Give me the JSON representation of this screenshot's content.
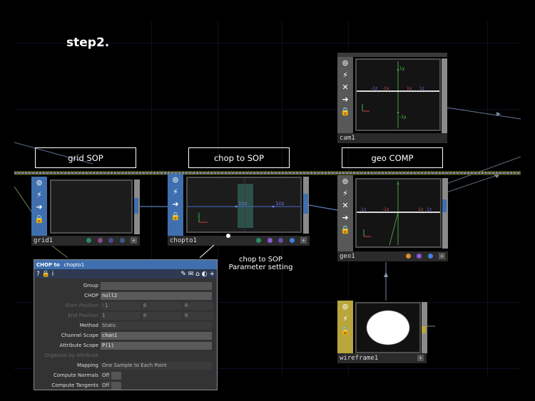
{
  "step_title": "step2.",
  "labels": {
    "grid_sop": "grid SOP",
    "chop_to_sop": "chop to SOP",
    "geo_comp": "geo COMP"
  },
  "annotation": {
    "line1": "chop to SOP",
    "line2": "Parameter setting"
  },
  "nodes": {
    "cam": {
      "name": "cam1",
      "axis_labels": [
        "1y",
        "-1x",
        "1x",
        "-1z",
        "1z",
        "-1y"
      ]
    },
    "grid": {
      "name": "grid1"
    },
    "chopto": {
      "name": "chopto1",
      "axis_labels": [
        "10z",
        "10z"
      ]
    },
    "geo": {
      "name": "geo1",
      "axis_labels": [
        "-1x",
        "1x",
        "-1z",
        "1z"
      ]
    },
    "wireframe": {
      "name": "wireframe1"
    }
  },
  "colors": {
    "blue_sidebar": "#3f6fae",
    "green_sidebar": "#5d5d5d",
    "yellow_sidebar": "#b8a63c",
    "dot_orange": "#e08a2c",
    "dot_purple": "#8a5ad8",
    "dot_blue": "#3f7fe0",
    "dot_green": "#2a8a6a"
  },
  "panel": {
    "type": "CHOP to",
    "name": "chopto1",
    "toolbar_left": "? 🔒 i",
    "params": [
      {
        "label": "Group",
        "value": "",
        "enabled": true
      },
      {
        "label": "CHOP",
        "value": "null2",
        "enabled": true
      },
      {
        "label": "Start Position",
        "v1": "-1",
        "v2": "0",
        "v3": "0",
        "enabled": false
      },
      {
        "label": "End Position",
        "v1": "1",
        "v2": "0",
        "v3": "0",
        "enabled": false
      },
      {
        "label": "Method",
        "value": "Static",
        "enabled": true
      },
      {
        "label": "Channel Scope",
        "value": "chan1",
        "enabled": true
      },
      {
        "label": "Attribute Scope",
        "value": "P(1)",
        "enabled": true
      },
      {
        "label": "Organize by Attribute",
        "value": "",
        "enabled": false
      },
      {
        "label": "Mapping",
        "value": "One Sample to Each Point",
        "enabled": true
      },
      {
        "label": "Compute Normals",
        "value": "Off",
        "enabled": true
      },
      {
        "label": "Compute Tangents",
        "value": "Off",
        "enabled": true
      }
    ]
  }
}
